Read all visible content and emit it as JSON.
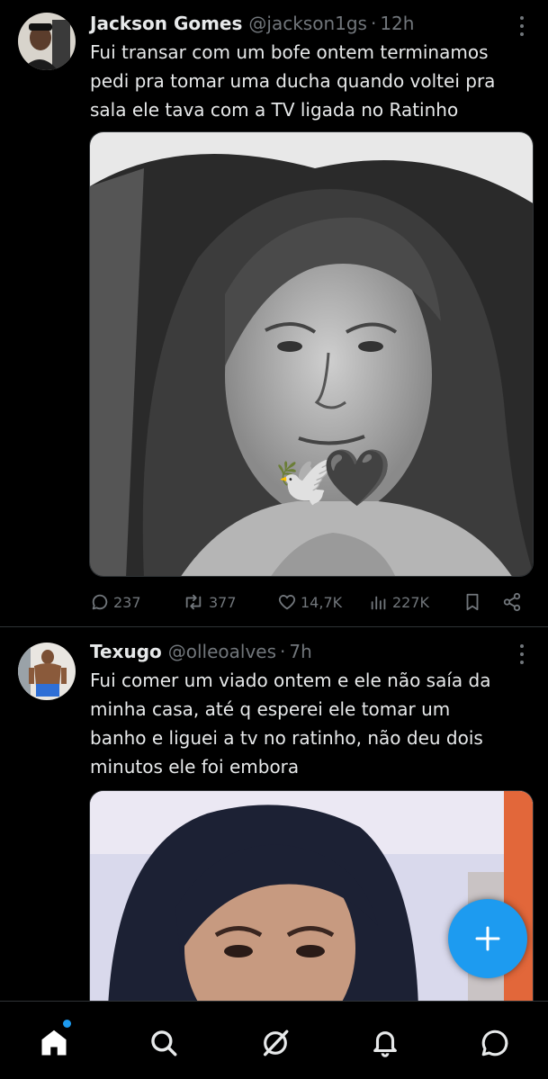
{
  "tweets": [
    {
      "name": "Jackson Gomes",
      "handle": "@jackson1gs",
      "separator": "·",
      "time": "12h",
      "text_lines": [
        "Fui transar com um bofe ontem terminamos",
        "pedi pra tomar uma ducha quando voltei pra",
        "sala ele tava com a TV ligada no Ratinho"
      ],
      "media_description": "grayscale-portrait-with-dove-and-black-heart-emoji",
      "media_emojis": [
        "🕊️",
        "🖤"
      ],
      "stats": {
        "replies": "237",
        "reposts": "377",
        "likes": "14,7K",
        "views": "227K"
      }
    },
    {
      "name": "Texugo",
      "handle": "@olleoalves",
      "separator": "·",
      "time": "7h",
      "text_lines": [
        "Fui comer um viado ontem e ele não saía da",
        "minha casa, até q esperei ele tomar um",
        "banho e liguei a tv no ratinho, não deu dois",
        "minutos ele foi embora"
      ]
    }
  ],
  "fab_icon": "plus-icon",
  "bottom_nav": [
    "home-icon",
    "search-icon",
    "grok-icon",
    "notifications-icon",
    "messages-icon"
  ],
  "colors": {
    "accent": "#1d9bf0",
    "muted": "#71767b",
    "text": "#e7e9ea",
    "background": "#000000"
  }
}
